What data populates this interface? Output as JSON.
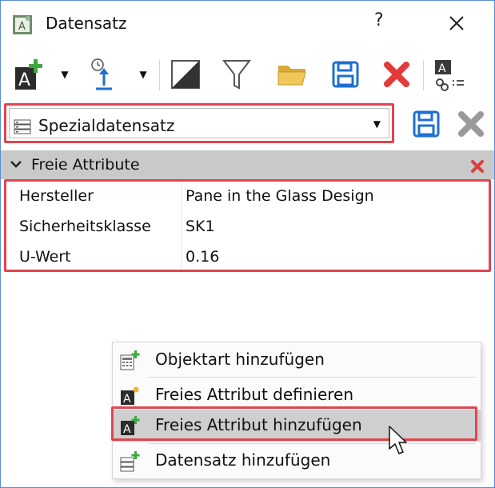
{
  "window": {
    "title": "Datensatz",
    "help_label": "?"
  },
  "toolbar": {
    "items": [
      {
        "icon": "add-attribute-icon"
      },
      {
        "icon": "import-icon"
      },
      {
        "icon": "contrast-icon"
      },
      {
        "icon": "filter-icon"
      },
      {
        "icon": "folder-open-icon"
      },
      {
        "icon": "save-icon"
      },
      {
        "icon": "delete-icon"
      },
      {
        "icon": "link-attribute-icon"
      }
    ]
  },
  "dataset": {
    "selected": "Spezialdatensatz"
  },
  "section": {
    "title": "Freie Attribute"
  },
  "attributes": [
    {
      "key": "Hersteller",
      "value": "Pane in the Glass Design"
    },
    {
      "key": "Sicherheitsklasse",
      "value": "SK1"
    },
    {
      "key": "U-Wert",
      "value": "0.16"
    }
  ],
  "context_menu": {
    "items": [
      {
        "label": "Objektart hinzufügen",
        "icon": "object-type-add-icon"
      },
      {
        "label": "Freies Attribut definieren",
        "icon": "attribute-define-icon"
      },
      {
        "label": "Freies Attribut hinzufügen",
        "icon": "attribute-add-icon"
      },
      {
        "label": "Datensatz hinzufügen",
        "icon": "dataset-add-icon"
      }
    ]
  },
  "colors": {
    "accent_red": "#e0454f",
    "save_blue": "#1e6fd0",
    "delete_red": "#e23b3b",
    "header_gray": "#c9c9c9",
    "highlight_gray": "#cfcfcf"
  }
}
